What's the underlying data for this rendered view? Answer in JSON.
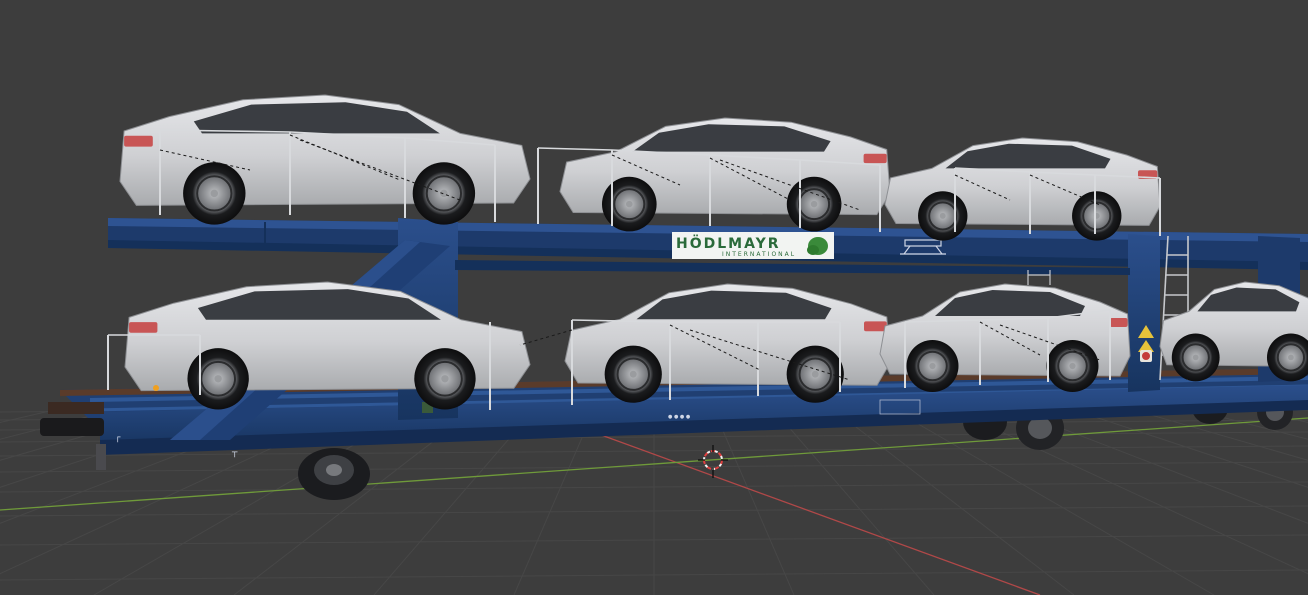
{
  "viewport": {
    "background": "#3d3d3d",
    "grid_color": "#474747",
    "x_axis_color": "#b04848",
    "y_axis_color": "#6f9a3a"
  },
  "wagon": {
    "body_color": "#1f3f75",
    "body_dark": "#142b52",
    "deck_color": "#2a4d86",
    "logo": {
      "name": "HÖDLMAYR",
      "sub": "INTERNATIONAL",
      "accent": "#3a8a3a"
    }
  },
  "cars": {
    "body_color": "#d2d3d6",
    "window_color": "#3a3d42",
    "tail_light": "#c85555",
    "upper_deck_count": 3,
    "lower_deck_count": 4
  },
  "cursor": {
    "icon": "3d-cursor-icon",
    "ring_color": "#e04040"
  }
}
